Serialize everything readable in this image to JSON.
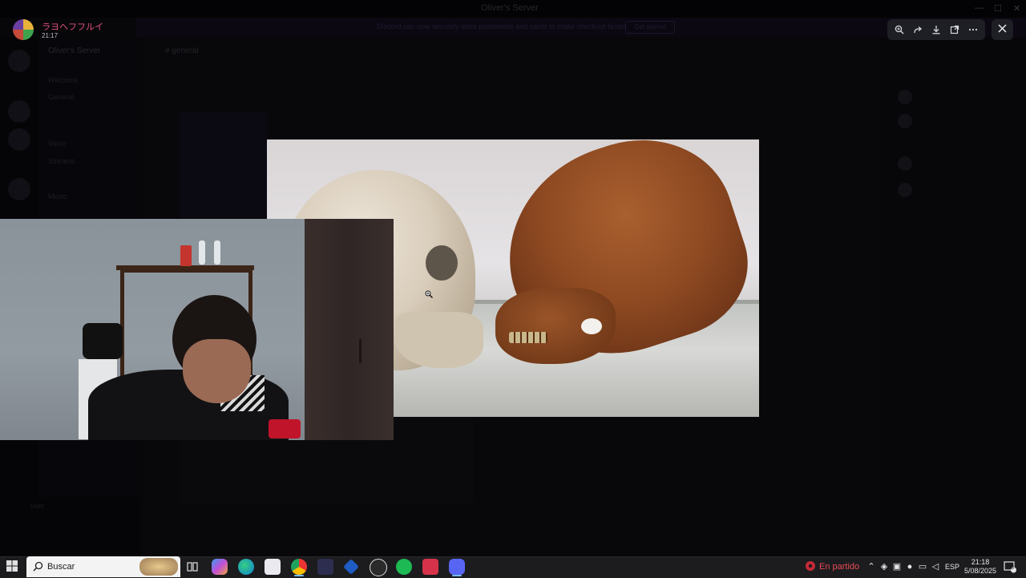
{
  "app_title": "Oliver's Server",
  "window_controls": [
    "—",
    "☐",
    "✕"
  ],
  "background": {
    "notice_text": "Discord can now securely store passwords and cards to make checkout faster.",
    "notice_button": "Get started",
    "server_name": "Oliver's Server",
    "channels": [
      "Welcome",
      "General",
      "Voice",
      "Streams",
      "Music"
    ],
    "chat_title": "# general",
    "user_label": "user"
  },
  "viewer": {
    "user_name": "ラヨヘフフルイ",
    "timestamp": "21:17",
    "toolbar": {
      "zoom_icon": "zoom-in-icon",
      "forward_icon": "forward-icon",
      "download_icon": "download-icon",
      "open_icon": "open-external-icon",
      "more_icon": "more-icon"
    },
    "close_icon": "close-icon"
  },
  "taskbar": {
    "search_label": "Buscar",
    "apps": [
      "task-view",
      "copilot",
      "edge",
      "store",
      "chrome",
      "vscode",
      "app-blue",
      "obs",
      "spotify",
      "app-red",
      "discord"
    ],
    "status_text": "En partido",
    "language": "ESP",
    "time": "21:18",
    "date": "5/08/2025",
    "notification_count": "8"
  }
}
